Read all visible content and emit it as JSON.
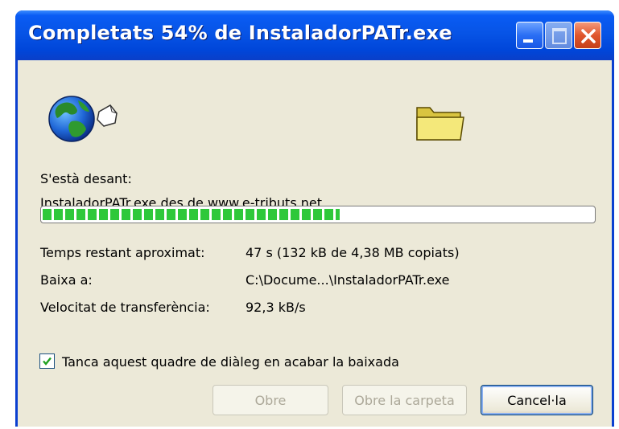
{
  "window": {
    "title": "Completats 54% de InstaladorPATr.exe",
    "titlebar_buttons": [
      "minimize",
      "maximize",
      "close"
    ]
  },
  "download": {
    "saving_label": "S'està desant:",
    "source_line": "InstaladorPATr.exe des de www.e-tributs.net",
    "progress_fraction": 0.54,
    "time_left_label": "Temps restant aproximat:",
    "time_left_value": "47 s (132 kB de 4,38 MB copiats)",
    "download_to_label": "Baixa a:",
    "download_to_value": "C:\\Docume...\\InstaladorPATr.exe",
    "rate_label": "Velocitat de transferència:",
    "rate_value": "92,3 kB/s"
  },
  "options": {
    "close_when_done_label": "Tanca aquest quadre de diàleg en acabar la baixada",
    "close_when_done_checked": true
  },
  "buttons": {
    "open": "Obre",
    "open_folder": "Obre la carpeta",
    "cancel": "Cancel·la"
  },
  "icons": {
    "source": "globe-with-document-icon",
    "destination": "folder-icon"
  },
  "colors": {
    "titlebar": "#0754e6",
    "dialog_bg": "#ece9d8",
    "progress_fill": "#2ec83a",
    "close_button": "#e0552c"
  }
}
